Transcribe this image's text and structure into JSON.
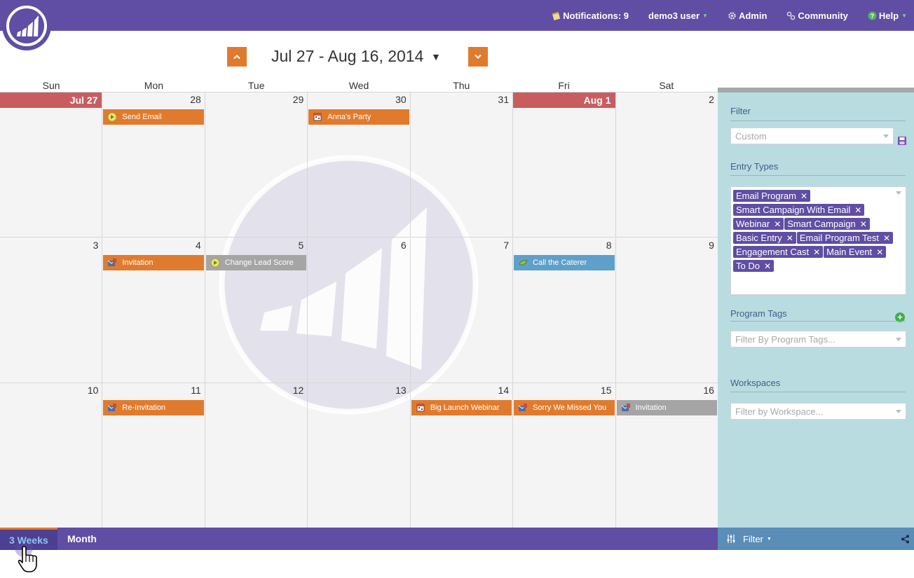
{
  "topnav": {
    "notifications": "Notifications: 9",
    "user": "demo3 user",
    "admin": "Admin",
    "community": "Community",
    "help": "Help"
  },
  "calendar": {
    "date_range": "Jul 27 - Aug 16, 2014",
    "day_names": [
      "Sun",
      "Mon",
      "Tue",
      "Wed",
      "Thu",
      "Fri",
      "Sat"
    ],
    "weeks": [
      [
        {
          "label": "Jul 27",
          "highlight": true
        },
        {
          "label": "28",
          "event": {
            "title": "Send Email",
            "color": "orange",
            "icon": "smart-campaign-icon"
          }
        },
        {
          "label": "29"
        },
        {
          "label": "30",
          "event": {
            "title": "Anna's Party",
            "color": "orange",
            "icon": "calendar-icon"
          }
        },
        {
          "label": "31"
        },
        {
          "label": "Aug 1",
          "highlight": true
        },
        {
          "label": "2"
        }
      ],
      [
        {
          "label": "3"
        },
        {
          "label": "4",
          "event": {
            "title": "Invitation",
            "color": "orange",
            "icon": "email-program-icon"
          }
        },
        {
          "label": "5",
          "event": {
            "title": "Change Lead Score",
            "color": "gray",
            "icon": "smart-campaign-icon"
          }
        },
        {
          "label": "6"
        },
        {
          "label": "7"
        },
        {
          "label": "8",
          "event": {
            "title": "Call the Caterer",
            "color": "blue",
            "icon": "todo-icon"
          }
        },
        {
          "label": "9"
        }
      ],
      [
        {
          "label": "10"
        },
        {
          "label": "11",
          "event": {
            "title": "Re-Invitation",
            "color": "orange",
            "icon": "email-program-icon"
          }
        },
        {
          "label": "12"
        },
        {
          "label": "13"
        },
        {
          "label": "14",
          "event": {
            "title": "Big Launch Webinar",
            "color": "orange",
            "icon": "calendar-icon"
          }
        },
        {
          "label": "15",
          "event": {
            "title": "Sorry We Missed You",
            "color": "orange",
            "icon": "email-program-icon"
          }
        },
        {
          "label": "16",
          "event": {
            "title": "Invitation",
            "color": "gray",
            "icon": "email-program-icon"
          }
        }
      ]
    ]
  },
  "sidebar": {
    "filter_title": "Filter",
    "filter_value": "Custom",
    "entry_types_title": "Entry Types",
    "entry_types": [
      "Email Program",
      "Smart Campaign With Email",
      "Webinar",
      "Smart Campaign",
      "Basic Entry",
      "Email Program Test",
      "Engagement Cast",
      "Main Event",
      "To Do"
    ],
    "program_tags_title": "Program Tags",
    "program_tags_placeholder": "Filter By Program Tags...",
    "workspaces_title": "Workspaces",
    "workspaces_placeholder": "Filter by Workspace..."
  },
  "bottombar": {
    "tab_3weeks": "3 Weeks",
    "tab_month": "Month",
    "filter_label": "Filter"
  },
  "colors": {
    "brand": "#5f4ea3",
    "accent": "#e07b2e",
    "highlight_day": "#c85d5f",
    "event_gray": "#a5a5a5",
    "event_blue": "#5ea0c9",
    "sidebar_bg": "#b9dce0"
  }
}
